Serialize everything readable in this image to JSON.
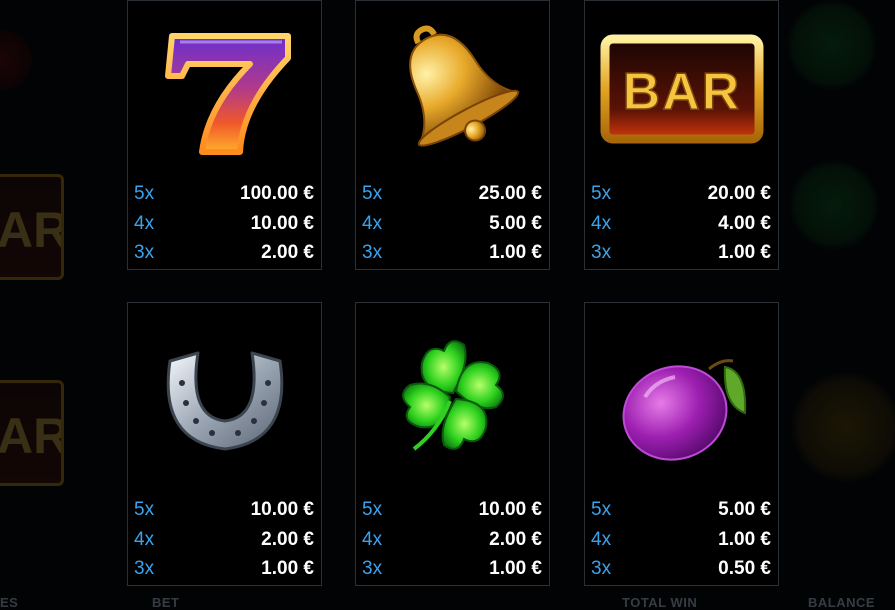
{
  "background": {
    "bar_text": "AR",
    "bottom_labels": [
      "ES",
      "BET",
      "TOTAL WIN",
      "BALANCE"
    ]
  },
  "paytable": [
    {
      "symbol": "seven-icon",
      "rows": [
        {
          "mult": "5x",
          "amount": "100.00 €"
        },
        {
          "mult": "4x",
          "amount": "10.00 €"
        },
        {
          "mult": "3x",
          "amount": "2.00 €"
        }
      ]
    },
    {
      "symbol": "bell-icon",
      "rows": [
        {
          "mult": "5x",
          "amount": "25.00 €"
        },
        {
          "mult": "4x",
          "amount": "5.00 €"
        },
        {
          "mult": "3x",
          "amount": "1.00 €"
        }
      ]
    },
    {
      "symbol": "bar-icon",
      "label": "BAR",
      "rows": [
        {
          "mult": "5x",
          "amount": "20.00 €"
        },
        {
          "mult": "4x",
          "amount": "4.00 €"
        },
        {
          "mult": "3x",
          "amount": "1.00 €"
        }
      ]
    },
    {
      "symbol": "horseshoe-icon",
      "rows": [
        {
          "mult": "5x",
          "amount": "10.00 €"
        },
        {
          "mult": "4x",
          "amount": "2.00 €"
        },
        {
          "mult": "3x",
          "amount": "1.00 €"
        }
      ]
    },
    {
      "symbol": "clover-icon",
      "rows": [
        {
          "mult": "5x",
          "amount": "10.00 €"
        },
        {
          "mult": "4x",
          "amount": "2.00 €"
        },
        {
          "mult": "3x",
          "amount": "1.00 €"
        }
      ]
    },
    {
      "symbol": "plum-icon",
      "rows": [
        {
          "mult": "5x",
          "amount": "5.00 €"
        },
        {
          "mult": "4x",
          "amount": "1.00 €"
        },
        {
          "mult": "3x",
          "amount": "0.50 €"
        }
      ]
    }
  ],
  "colors": {
    "multiplier": "#3aa3ee",
    "amount": "#ffffff",
    "card_border": "#2b2f36"
  }
}
